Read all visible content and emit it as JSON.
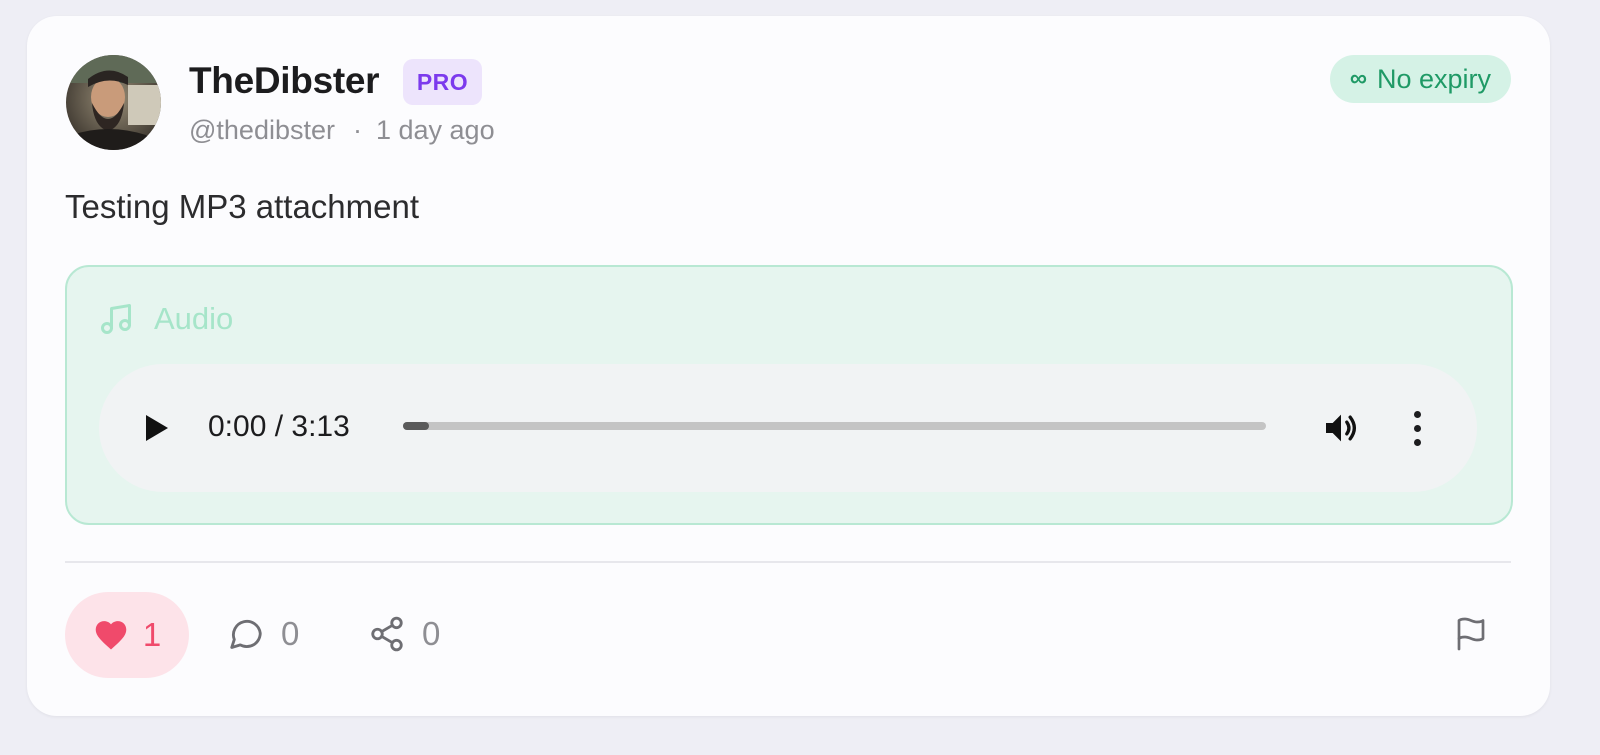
{
  "post": {
    "display_name": "TheDibster",
    "badge": "PRO",
    "handle": "@thedibster",
    "separator": "·",
    "time_ago": "1 day ago",
    "expiry": {
      "symbol": "∞",
      "label": "No expiry"
    },
    "text": "Testing MP3 attachment"
  },
  "attachment": {
    "label": "Audio",
    "icon": "music-note-icon",
    "player": {
      "time": "0:00 / 3:13",
      "progress_fraction": 0.03
    }
  },
  "actions": {
    "likes": "1",
    "comments": "0",
    "shares": "0"
  },
  "colors": {
    "accent_green": "#1f9a66",
    "pro_purple": "#7c3aed",
    "like_red": "#f04a6b"
  }
}
